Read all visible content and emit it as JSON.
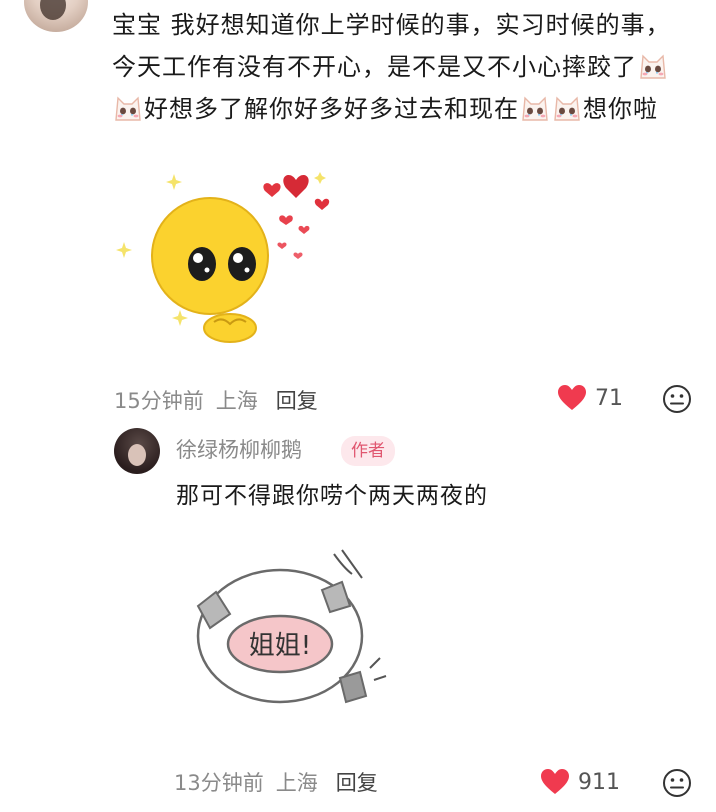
{
  "main_comment": {
    "line1": "宝宝 我好想知道你上学时候的事，实习时候的事，",
    "line2": "今天工作有没有不开心，是不是又不小心摔跤了",
    "line3a": "好想多了解你好多好多过去和现在",
    "line3b": "想你啦",
    "time": "15分钟前",
    "location": "上海",
    "reply_label": "回复",
    "likes": "71"
  },
  "reply": {
    "author": "徐绿杨柳柳鹅",
    "badge": "作者",
    "text": "那可不得跟你唠个两天两夜的",
    "sticker_text": "姐姐!",
    "time": "13分钟前",
    "location": "上海",
    "reply_label": "回复",
    "likes": "911"
  },
  "colors": {
    "heart": "#f03a4f",
    "badge_bg": "#fde8ec",
    "badge_text": "#e0566f",
    "meta_text": "#8a8a8a"
  },
  "icons": {
    "like": "heart-icon",
    "more": "neutral-face-icon",
    "emoji": "crying-cat-emoji"
  }
}
